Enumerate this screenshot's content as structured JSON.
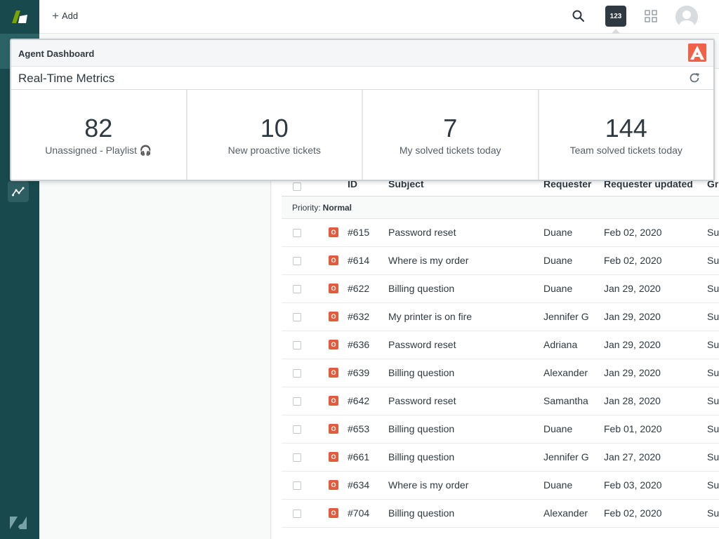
{
  "topbar": {
    "add_label": "Add",
    "app_badge": "123"
  },
  "dashboard": {
    "title": "Agent Dashboard",
    "section_title": "Real-Time Metrics",
    "metrics": [
      {
        "value": "82",
        "label": "Unassigned - Playlist 🎧"
      },
      {
        "value": "10",
        "label": "New proactive tickets"
      },
      {
        "value": "7",
        "label": "My solved tickets today"
      },
      {
        "value": "144",
        "label": "Team solved tickets today"
      }
    ]
  },
  "table": {
    "columns": {
      "id": "ID",
      "subject": "Subject",
      "requester": "Requester",
      "updated": "Requester updated",
      "group": "Gr"
    },
    "group_label": "Priority:",
    "group_value": "Normal",
    "status_letter": "O",
    "rows": [
      {
        "id": "#615",
        "subject": "Password reset",
        "requester": "Duane",
        "updated": "Feb 02, 2020",
        "group": "Su"
      },
      {
        "id": "#614",
        "subject": "Where is my order",
        "requester": "Duane",
        "updated": "Feb 02, 2020",
        "group": "Su"
      },
      {
        "id": "#622",
        "subject": "Billing question",
        "requester": "Duane",
        "updated": "Jan 29, 2020",
        "group": "Su"
      },
      {
        "id": "#632",
        "subject": "My printer is on fire",
        "requester": "Jennifer G",
        "updated": "Jan 29, 2020",
        "group": "Su"
      },
      {
        "id": "#636",
        "subject": "Password reset",
        "requester": "Adriana",
        "updated": "Jan 29, 2020",
        "group": "Su"
      },
      {
        "id": "#639",
        "subject": "Billing question",
        "requester": "Alexander",
        "updated": "Jan 29, 2020",
        "group": "Su"
      },
      {
        "id": "#642",
        "subject": "Password reset",
        "requester": "Samantha",
        "updated": "Jan 28, 2020",
        "group": "Su"
      },
      {
        "id": "#653",
        "subject": "Billing question",
        "requester": "Duane",
        "updated": "Feb 01, 2020",
        "group": "Su"
      },
      {
        "id": "#661",
        "subject": "Billing question",
        "requester": "Jennifer G",
        "updated": "Jan 27, 2020",
        "group": "Su"
      },
      {
        "id": "#634",
        "subject": "Where is my order",
        "requester": "Duane",
        "updated": "Feb 03, 2020",
        "group": "Su"
      },
      {
        "id": "#704",
        "subject": "Billing question",
        "requester": "Alexander",
        "updated": "Feb 02, 2020",
        "group": "Su"
      }
    ]
  },
  "colors": {
    "nav_bg": "#17494d",
    "status_open": "#e35b3b",
    "app_badge_bg": "#2f3941",
    "dashboard_logo": "#f0614a"
  }
}
